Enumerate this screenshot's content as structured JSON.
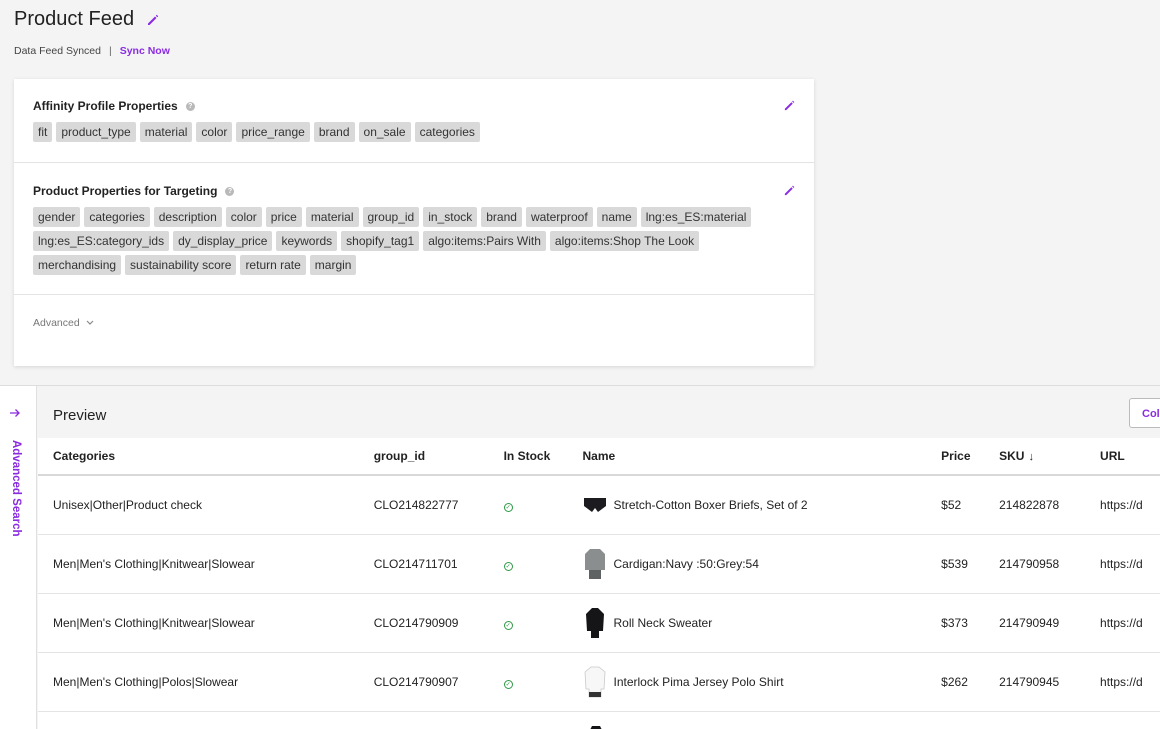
{
  "header": {
    "title": "Product Feed",
    "sync_status": "Data Feed Synced",
    "separator": "|",
    "sync_link": "Sync Now"
  },
  "affinity": {
    "title": "Affinity Profile Properties",
    "tags": [
      "fit",
      "product_type",
      "material",
      "color",
      "price_range",
      "brand",
      "on_sale",
      "categories"
    ]
  },
  "targeting": {
    "title": "Product Properties for Targeting",
    "tags": [
      "gender",
      "categories",
      "description",
      "color",
      "price",
      "material",
      "group_id",
      "in_stock",
      "brand",
      "waterproof",
      "name",
      "lng:es_ES:material",
      "lng:es_ES:category_ids",
      "dy_display_price",
      "keywords",
      "shopify_tag1",
      "algo:items:Pairs With",
      "algo:items:Shop The Look",
      "merchandising",
      "sustainability score",
      "return rate",
      "margin"
    ]
  },
  "advanced": {
    "label": "Advanced"
  },
  "sidebar": {
    "label": "Advanced Search"
  },
  "preview": {
    "title": "Preview",
    "column_button": "Columns"
  },
  "table": {
    "headers": {
      "categories": "Categories",
      "group_id": "group_id",
      "in_stock": "In Stock",
      "name": "Name",
      "price": "Price",
      "sku": "SKU",
      "url": "URL"
    },
    "rows": [
      {
        "categories": "Unisex|Other|Product check",
        "group_id": "CLO214822777",
        "name": "Stretch-Cotton Boxer Briefs, Set of 2",
        "price": "$52",
        "sku": "214822878",
        "url": "https://d"
      },
      {
        "categories": "Men|Men's Clothing|Knitwear|Slowear",
        "group_id": "CLO214711701",
        "name": "Cardigan:Navy :50:Grey:54",
        "price": "$539",
        "sku": "214790958",
        "url": "https://d"
      },
      {
        "categories": "Men|Men's Clothing|Knitwear|Slowear",
        "group_id": "CLO214790909",
        "name": "Roll Neck Sweater",
        "price": "$373",
        "sku": "214790949",
        "url": "https://d"
      },
      {
        "categories": "Men|Men's Clothing|Polos|Slowear",
        "group_id": "CLO214790907",
        "name": "Interlock Pima Jersey Polo Shirt",
        "price": "$262",
        "sku": "214790945",
        "url": "https://d"
      }
    ]
  },
  "colors": {
    "accent": "#8a2be2",
    "check": "#2e9a48",
    "tag_bg": "#d9d9d9"
  }
}
